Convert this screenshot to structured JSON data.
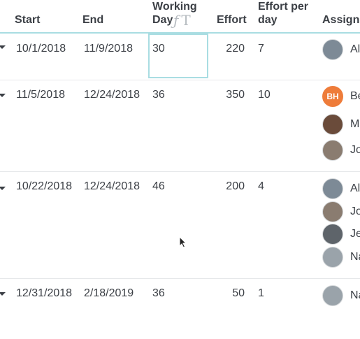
{
  "columns": {
    "start": "Start",
    "end": "End",
    "working_days_line1": "Working",
    "working_days_line2": "Day",
    "effort": "Effort",
    "effort_per_day_line1": "Effort per",
    "effort_per_day_line2": "day",
    "assignee": "Assignee"
  },
  "icons": [
    "formula-icon",
    "text-format-icon"
  ],
  "rows": [
    {
      "start": "10/1/2018",
      "end": "11/9/2018",
      "working_days": "30",
      "effort": "220",
      "effort_per_day": "7",
      "assignees": [
        {
          "initials": "",
          "name": "Al",
          "color": "#7d8a96"
        }
      ]
    },
    {
      "start": "11/5/2018",
      "end": "12/24/2018",
      "working_days": "36",
      "effort": "350",
      "effort_per_day": "10",
      "assignees": [
        {
          "initials": "BH",
          "name": "Be",
          "color": "#ee7c3a"
        },
        {
          "initials": "",
          "name": "M Ra",
          "color": "#6a4b3a"
        },
        {
          "initials": "",
          "name": "Jo",
          "color": "#8a7c70"
        }
      ]
    },
    {
      "start": "10/22/2018",
      "end": "12/24/2018",
      "working_days": "46",
      "effort": "200",
      "effort_per_day": "4",
      "assignees": [
        {
          "initials": "",
          "name": "Al",
          "color": "#7d8a96"
        },
        {
          "initials": "",
          "name": "Jo",
          "color": "#8a7c70"
        },
        {
          "initials": "",
          "name": "Je",
          "color": "#5e646a"
        },
        {
          "initials": "",
          "name": "Na",
          "color": "#9aa3aa"
        }
      ]
    },
    {
      "start": "12/31/2018",
      "end": "2/18/2019",
      "working_days": "36",
      "effort": "50",
      "effort_per_day": "1",
      "assignees": [
        {
          "initials": "",
          "name": "Na",
          "color": "#9aa3aa"
        }
      ]
    }
  ],
  "colors": {
    "selection": "#a9dde2",
    "row_border": "#e6e8ea",
    "text": "#3b3f45"
  }
}
